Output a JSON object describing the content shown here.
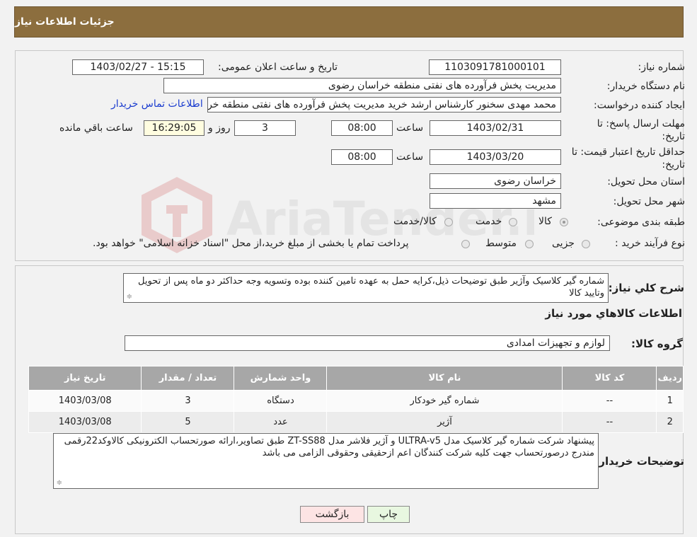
{
  "header": {
    "title": "جزئیات اطلاعات نیاز"
  },
  "form": {
    "need_number_label": "شماره نیاز:",
    "need_number": "1103091781000101",
    "announce_label": "تاریخ و ساعت اعلان عمومی:",
    "announce_value": "1403/02/27 - 15:15",
    "buyer_org_label": "نام دستگاه خریدار:",
    "buyer_org": "مدیریت پخش فرآورده های نفتی منطقه خراسان رضوی",
    "creator_label": "ایجاد کننده درخواست:",
    "creator": "محمد مهدی سخنور کارشناس ارشد خرید مدیریت پخش فرآورده های نفتی منطقه خراسان رضوی",
    "contact_link": "اطلاعات تماس خریدار",
    "deadline_label_1": "مهلت ارسال پاسخ: تا",
    "deadline_label_2": "تاریخ:",
    "deadline_date": "1403/02/31",
    "time_word": "ساعت",
    "deadline_time": "08:00",
    "days_value": "3",
    "days_word": "روز و",
    "remaining_time": "16:29:05",
    "remaining_word": "ساعت باقي مانده",
    "validity_label_1": "حداقل تاریخ اعتبار قیمت: تا",
    "validity_label_2": "تاریخ:",
    "validity_date": "1403/03/20",
    "validity_time": "08:00",
    "province_label": "استان محل تحویل:",
    "province": "خراسان رضوی",
    "city_label": "شهر محل تحویل:",
    "city": "مشهد",
    "category_label": "طبقه بندی موضوعی:",
    "category_options": [
      "کالا",
      "خدمت",
      "کالا/خدمت"
    ],
    "category_selected": "کالا",
    "process_label": "نوع فرآیند خرید :",
    "process_options": [
      "جزیی",
      "متوسط"
    ],
    "process_note": "پرداخت تمام یا بخشی از مبلغ خرید،از محل \"اسناد خزانه اسلامی\" خواهد بود."
  },
  "details": {
    "summary_label": "شرح کلي نياز:",
    "summary_text": "شماره گیر کلاسیک وآژیر طبق توضیحات ذیل،کرایه حمل به عهده تامین کننده بوده وتسویه وجه حداکثر دو ماه پس از تحویل وتایید کالا",
    "goods_info_title": "اطلاعات کالاهاي مورد نياز",
    "goods_group_label": "گروه کالا:",
    "goods_group": "لوازم و تجهیزات امدادی"
  },
  "table": {
    "headers": [
      "ردیف",
      "کد کالا",
      "نام کالا",
      "واحد شمارش",
      "تعداد / مقدار",
      "تاریخ نیاز"
    ],
    "rows": [
      [
        "1",
        "--",
        "شماره گیر خودکار",
        "دستگاه",
        "3",
        "1403/03/08"
      ],
      [
        "2",
        "--",
        "آژیر",
        "عدد",
        "5",
        "1403/03/08"
      ]
    ]
  },
  "buyer_notes": {
    "label": "توضیحات خریدار:",
    "text": "پیشنهاد شرکت شماره گیر کلاسیک مدل ULTRA-v5 و آژیر فلاشر مدل ZT-SS88 طبق تصاویر،ارائه صورتحساب الکترونیکی کالاوکد22رقمی مندرج درصورتحساب جهت کلیه شرکت کنندگان اعم ازحقیقی وحقوقی الزامی می باشد"
  },
  "buttons": {
    "print": "چاپ",
    "back": "بازگشت"
  },
  "watermark": {
    "text": "AriaTender.neT"
  },
  "colors": {
    "header_bg": "#8c6e3e",
    "table_header": "#a7a7a7",
    "print_btn": "#e8f7e0",
    "back_btn": "#fde4e4",
    "link": "#1a3ccf"
  }
}
